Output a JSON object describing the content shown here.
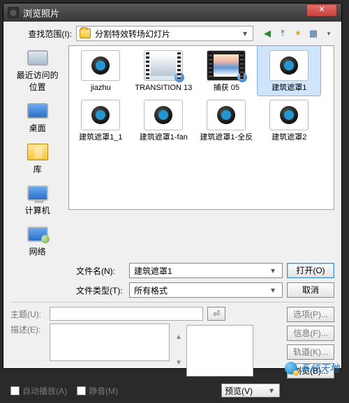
{
  "titlebar": {
    "title": "浏览照片",
    "close": "✕"
  },
  "lookin": {
    "label": "查找范围(I):",
    "value": "分割特效转场幻灯片"
  },
  "nav": {
    "back": "←",
    "up": "↥",
    "newfolder": "✧",
    "views": "▦"
  },
  "places": [
    {
      "label": "最近访问的位置",
      "icon": "recent"
    },
    {
      "label": "桌面",
      "icon": "desktop"
    },
    {
      "label": "库",
      "icon": "library"
    },
    {
      "label": "计算机",
      "icon": "computer"
    },
    {
      "label": "网络",
      "icon": "network"
    }
  ],
  "files": [
    {
      "name": "jiazhu",
      "thumb": "file",
      "selected": false
    },
    {
      "name": "TRANSITION 13",
      "thumb": "video",
      "selected": false
    },
    {
      "name": "捕获 05",
      "thumb": "capture",
      "selected": false
    },
    {
      "name": "建筑遮罩1",
      "thumb": "file",
      "selected": true
    },
    {
      "name": "建筑遮罩1_1",
      "thumb": "file",
      "selected": false
    },
    {
      "name": "建筑遮罩1-fan",
      "thumb": "file",
      "selected": false
    },
    {
      "name": "建筑遮罩1-全反",
      "thumb": "file",
      "selected": false
    },
    {
      "name": "建筑遮罩2",
      "thumb": "file",
      "selected": false
    }
  ],
  "filename": {
    "label": "文件名(N):",
    "value": "建筑遮罩1"
  },
  "filetype": {
    "label": "文件类型(T):",
    "value": "所有格式"
  },
  "buttons": {
    "open": "打开(O)",
    "cancel": "取消"
  },
  "subject": {
    "label": "主题(U):",
    "value": ""
  },
  "desc": {
    "label": "描述(E):",
    "value": ""
  },
  "side_buttons": {
    "options": "选项(P)...",
    "info": "信息(F)...",
    "tracks": "轨道(K)...",
    "browse": "浏览(B)..."
  },
  "autoplay": "自动播放(A)",
  "mute": "静音(M)",
  "preview_label": "预览(V)",
  "watermark": "系统天地"
}
